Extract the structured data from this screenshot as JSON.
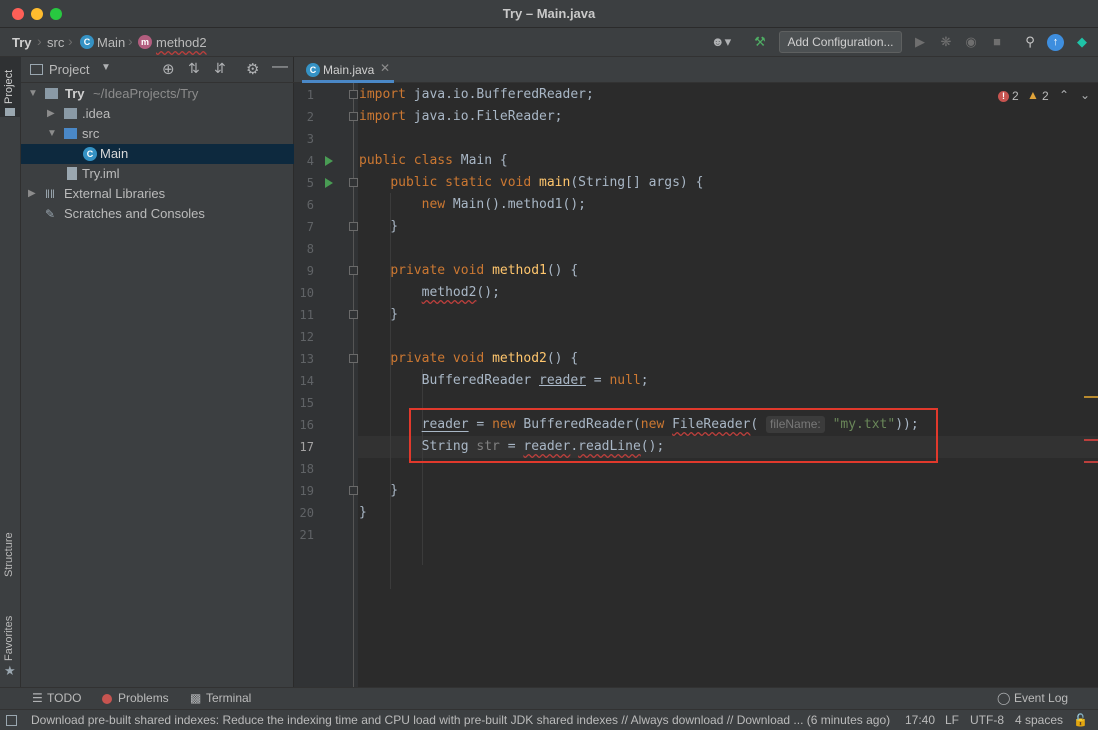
{
  "window": {
    "title": "Try – Main.java"
  },
  "breadcrumbs": [
    "Try",
    "src",
    "Main",
    "method2"
  ],
  "toolbar": {
    "add_configuration": "Add Configuration..."
  },
  "project_panel": {
    "title": "Project",
    "tree": [
      {
        "label": "Try",
        "extra": "~/IdeaProjects/Try",
        "icon": "folder-icon"
      },
      {
        "label": ".idea",
        "icon": "folder-icon"
      },
      {
        "label": "src",
        "icon": "folder-icon"
      },
      {
        "label": "Main",
        "icon": "java-class-icon",
        "selected": true
      },
      {
        "label": "Try.iml",
        "icon": "file-icon"
      },
      {
        "label": "External Libraries",
        "icon": "library-icon"
      },
      {
        "label": "Scratches and Consoles",
        "icon": "scratches-icon"
      }
    ]
  },
  "side_tabs": {
    "project": "Project",
    "structure": "Structure",
    "favorites": "Favorites"
  },
  "editor": {
    "tab": "Main.java",
    "errors": "2",
    "warnings": "2",
    "line_numbers": [
      "1",
      "2",
      "3",
      "4",
      "5",
      "6",
      "7",
      "8",
      "9",
      "10",
      "11",
      "12",
      "13",
      "14",
      "15",
      "16",
      "17",
      "18",
      "19",
      "20",
      "21"
    ],
    "current_line": "17",
    "hint": "fileName:"
  },
  "bottom_tools": {
    "todo": "TODO",
    "problems": "Problems",
    "terminal": "Terminal",
    "event_log": "Event Log"
  },
  "status": {
    "message": "Download pre-built shared indexes: Reduce the indexing time and CPU load with pre-built JDK shared indexes // Always download // Download ... (6 minutes ago)",
    "position": "17:40",
    "line_sep": "LF",
    "encoding": "UTF-8",
    "indent": "4 spaces"
  },
  "colors": {
    "accent": "#4a88c7",
    "run": "#499c54",
    "error": "#e1392c"
  }
}
